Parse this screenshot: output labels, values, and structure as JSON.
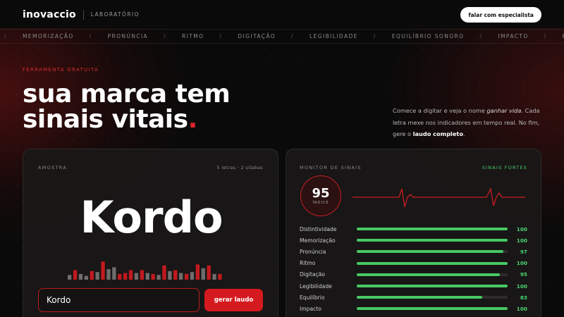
{
  "header": {
    "logo": "inovaccio",
    "section": "LABORATÓRIO",
    "cta": "falar com especialista"
  },
  "marquee": {
    "items": [
      "MEMORIZAÇÃO",
      "PRONÚNCIA",
      "RITMO",
      "DIGITAÇÃO",
      "LEGIBILIDADE",
      "EQUILÍBRIO SONORO",
      "IMPACTO",
      "PRES"
    ]
  },
  "hero": {
    "eyebrow": "FERRAMENTA GRATUITA",
    "line1": "sua marca tem",
    "line2": "sinais vitais",
    "dot": ".",
    "desc_a": "Comece a digitar e veja o nome ",
    "desc_em": "ganhar vida",
    "desc_b": ". Cada letra mexe nos indicadores em tempo real. No fim, gere o ",
    "desc_strong": "laudo completo",
    "desc_c": "."
  },
  "sample": {
    "label": "AMOSTRA",
    "meta": "5 letras · 2 sílabas",
    "word": "Kordo",
    "input_value": "Kordo",
    "button": "gerar laudo",
    "bars": [
      {
        "v": 0.25,
        "c": "gray"
      },
      {
        "v": 0.5,
        "c": "red"
      },
      {
        "v": 0.3,
        "c": "gray"
      },
      {
        "v": 0.2,
        "c": "gray"
      },
      {
        "v": 0.45,
        "c": "red"
      },
      {
        "v": 0.4,
        "c": "gray"
      },
      {
        "v": 0.95,
        "c": "red"
      },
      {
        "v": 0.55,
        "c": "gray"
      },
      {
        "v": 0.65,
        "c": "gray"
      },
      {
        "v": 0.3,
        "c": "red"
      },
      {
        "v": 0.35,
        "c": "red"
      },
      {
        "v": 0.5,
        "c": "red"
      },
      {
        "v": 0.35,
        "c": "gray"
      },
      {
        "v": 0.5,
        "c": "red"
      },
      {
        "v": 0.35,
        "c": "gray"
      },
      {
        "v": 0.3,
        "c": "red"
      },
      {
        "v": 0.25,
        "c": "gray"
      },
      {
        "v": 0.75,
        "c": "red"
      },
      {
        "v": 0.45,
        "c": "gray"
      },
      {
        "v": 0.5,
        "c": "red"
      },
      {
        "v": 0.35,
        "c": "gray"
      },
      {
        "v": 0.3,
        "c": "red"
      },
      {
        "v": 0.4,
        "c": "gray"
      },
      {
        "v": 0.8,
        "c": "red"
      },
      {
        "v": 0.6,
        "c": "gray"
      },
      {
        "v": 0.75,
        "c": "red"
      },
      {
        "v": 0.3,
        "c": "gray"
      },
      {
        "v": 0.3,
        "c": "red"
      }
    ]
  },
  "monitor": {
    "label": "MONITOR DE SINAIS",
    "status": "SINAIS FORTES",
    "score": "95",
    "score_label": "ÍNDICE",
    "metrics": [
      {
        "label": "Distintividade",
        "value": "100",
        "pct": 1.0
      },
      {
        "label": "Memorização",
        "value": "100",
        "pct": 1.0
      },
      {
        "label": "Pronúncia",
        "value": "97",
        "pct": 0.97
      },
      {
        "label": "Ritmo",
        "value": "100",
        "pct": 1.0
      },
      {
        "label": "Digitação",
        "value": "95",
        "pct": 0.95
      },
      {
        "label": "Legibilidade",
        "value": "100",
        "pct": 1.0
      },
      {
        "label": "Equilíbrio",
        "value": "83",
        "pct": 0.83
      },
      {
        "label": "Impacto",
        "value": "100",
        "pct": 1.0
      }
    ]
  },
  "colors": {
    "accent": "#d41a1f",
    "good": "#46c965",
    "bar_gray": "#6f6c6c",
    "bar_red": "#c3191e"
  }
}
